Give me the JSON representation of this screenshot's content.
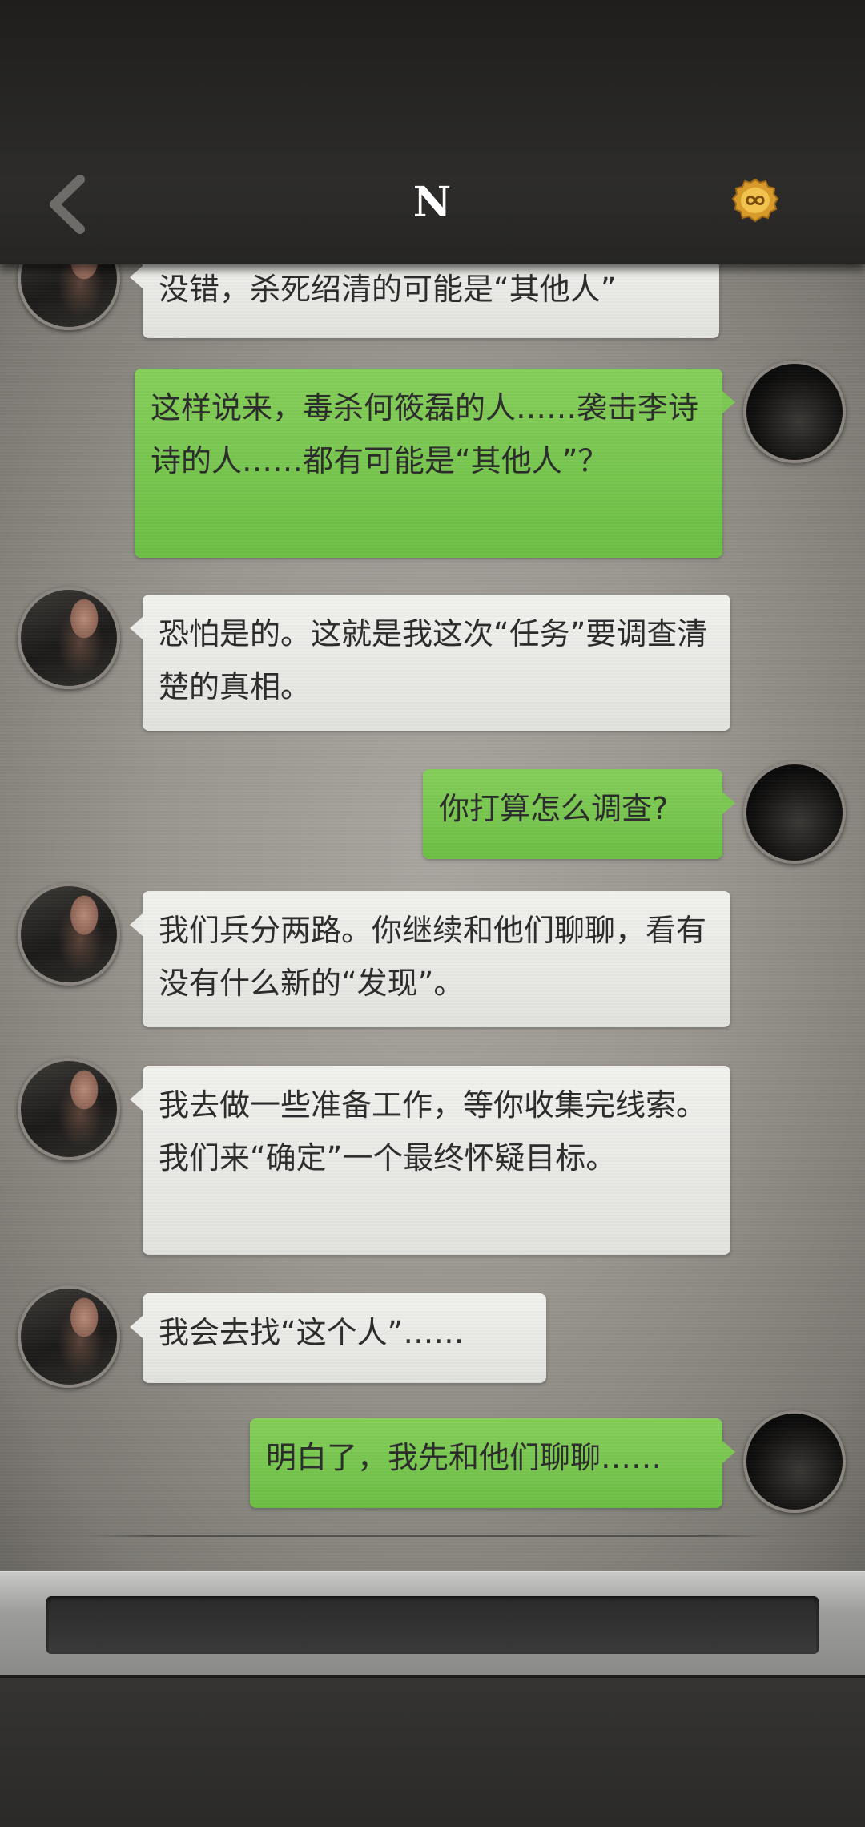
{
  "header": {
    "title": "N",
    "back_icon": "chevron-left-icon",
    "coin_icon": "infinity-coin-icon"
  },
  "messages": [
    {
      "side": "left",
      "text": "没错，杀死绍清的可能是“其他人”"
    },
    {
      "side": "right",
      "text": "这样说来，毒杀何筱磊的人……袭击李诗诗的人……都有可能是“其他人”？"
    },
    {
      "side": "left",
      "text": "恐怕是的。这就是我这次“任务”要调查清楚的真相。"
    },
    {
      "side": "right",
      "text": "你打算怎么调查?"
    },
    {
      "side": "left",
      "text": "我们兵分两路。你继续和他们聊聊，看有没有什么新的“发现”。"
    },
    {
      "side": "left",
      "text": "我去做一些准备工作，等你收集完线索。我们来“确定”一个最终怀疑目标。"
    },
    {
      "side": "left",
      "text": "我会去找“这个人”……"
    },
    {
      "side": "right",
      "text": "明白了，我先和他们聊聊……"
    }
  ],
  "input": {
    "placeholder": ""
  },
  "colors": {
    "bubble_green": "#7cc852",
    "bubble_gray": "#ecece8",
    "coin_gold": "#e2a934"
  }
}
